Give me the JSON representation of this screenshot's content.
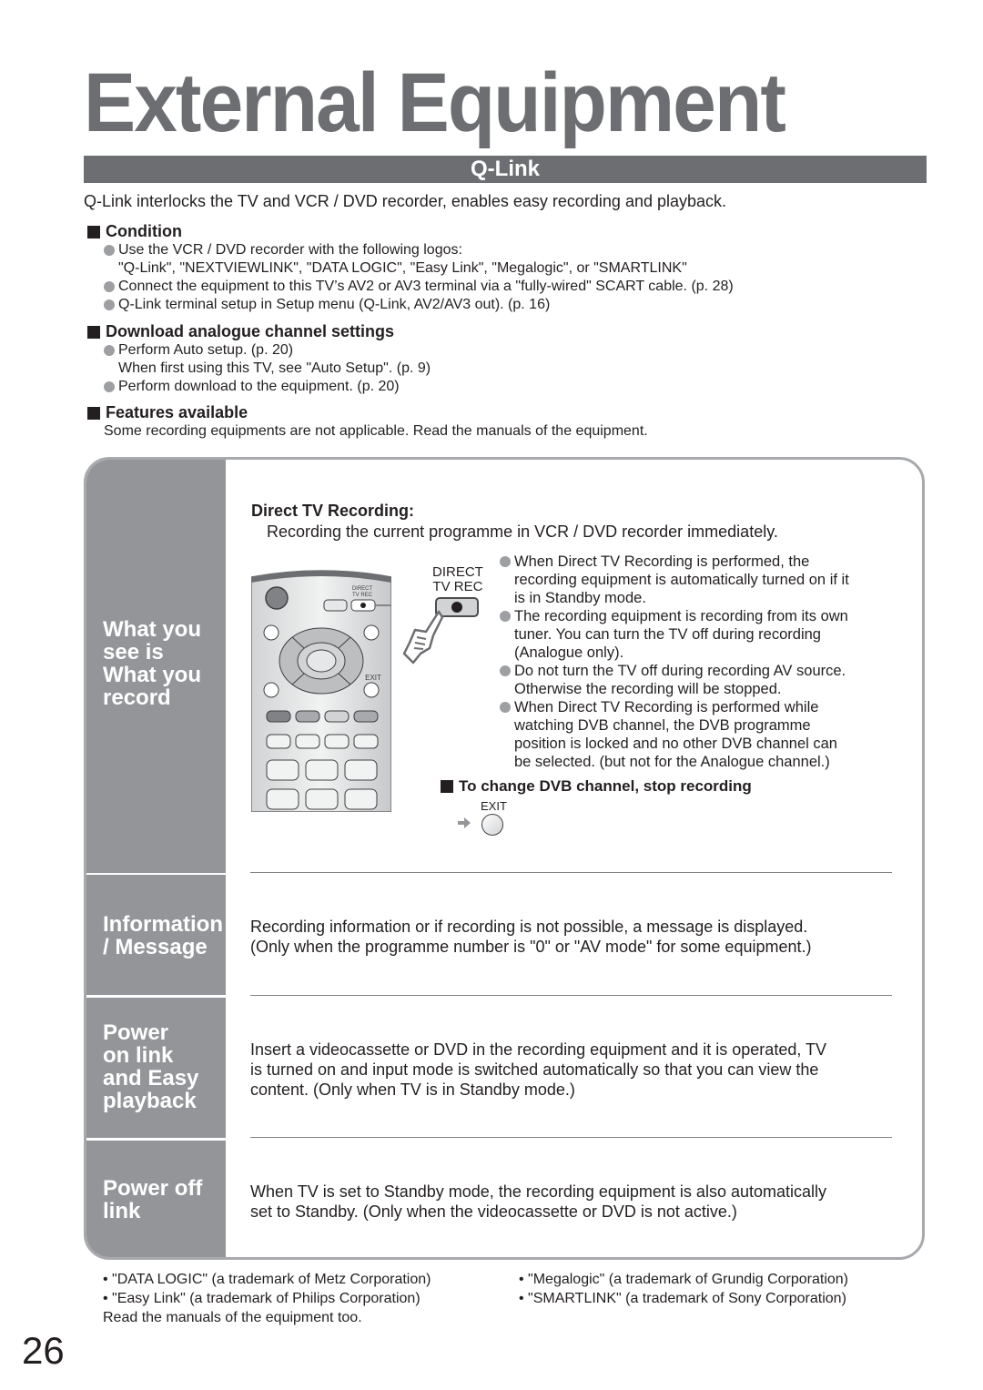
{
  "page": {
    "title": "External Equipment",
    "section": "Q-Link",
    "intro": "Q-Link interlocks the TV and VCR / DVD recorder, enables easy recording and playback.",
    "page_number": "26"
  },
  "condition": {
    "heading": "Condition",
    "items": [
      {
        "bullet": true,
        "text": "Use the VCR / DVD recorder with the following logos:"
      },
      {
        "bullet": false,
        "text": "\"Q-Link\", \"NEXTVIEWLINK\", \"DATA LOGIC\", \"Easy Link\", \"Megalogic\", or \"SMARTLINK\""
      },
      {
        "bullet": true,
        "text": "Connect the equipment to this TV’s AV2 or AV3 terminal via a \"fully-wired\" SCART cable. (p. 28)"
      },
      {
        "bullet": true,
        "text": "Q-Link terminal setup in Setup menu (Q-Link, AV2/AV3 out). (p. 16)"
      }
    ]
  },
  "download": {
    "heading": "Download analogue channel settings",
    "items": [
      {
        "bullet": true,
        "text": "Perform Auto setup. (p. 20)"
      },
      {
        "bullet": false,
        "text": "When first using this TV, see \"Auto Setup\". (p. 9)"
      },
      {
        "bullet": true,
        "text": "Perform download to the equipment. (p. 20)"
      }
    ]
  },
  "features": {
    "heading": "Features available",
    "note": "Some recording equipments are not applicable. Read the manuals of the equipment."
  },
  "rows": {
    "wysiwyr": {
      "label": [
        "What you",
        "see is",
        "What you",
        "record"
      ],
      "subtitle": "Direct TV Recording:",
      "description": "Recording the current programme in VCR / DVD recorder immediately.",
      "button_label_line1": "DIRECT",
      "button_label_line2": "TV REC",
      "remote_small_label1": "DIRECT",
      "remote_small_label2": "TV REC",
      "remote_exit_label": "EXIT",
      "bullets": [
        [
          "When Direct TV Recording is performed, the",
          "recording equipment is automatically turned on if it",
          "is in Standby mode."
        ],
        [
          "The recording equipment is recording from its own",
          "tuner. You can turn the TV off during recording",
          "(Analogue only)."
        ],
        [
          "Do not turn the TV off during recording AV source.",
          "Otherwise the recording will be stopped."
        ],
        [
          "When Direct TV Recording is performed while",
          "watching DVB channel, the DVB programme",
          "position is locked and no other DVB channel can",
          "be selected. (but not for the Analogue channel.)"
        ]
      ],
      "change_heading": "To change DVB channel, stop recording",
      "exit_label": "EXIT"
    },
    "info": {
      "label": [
        "Information",
        "/ Message"
      ],
      "lines": [
        "Recording information or if recording is not possible, a message is displayed.",
        "(Only when the programme number is \"0\" or \"AV mode\" for some equipment.)"
      ]
    },
    "power_on": {
      "label": [
        "Power",
        "on link",
        "and Easy",
        "playback"
      ],
      "lines": [
        "Insert a videocassette or DVD in the recording equipment and it is operated, TV",
        "is turned on and input mode is switched automatically so that you can view the",
        "content. (Only when TV is in Standby mode.)"
      ]
    },
    "power_off": {
      "label": [
        "Power off",
        "link"
      ],
      "lines": [
        "When TV is set to Standby mode, the recording equipment is also automatically",
        "set to Standby. (Only when the videocassette or DVD is not active.)"
      ]
    }
  },
  "footer": {
    "left": [
      "• \"DATA LOGIC\" (a trademark of Metz Corporation)",
      "• \"Easy Link\" (a trademark of Philips Corporation)",
      "Read the manuals of the equipment too."
    ],
    "right": [
      "• \"Megalogic\" (a trademark of Grundig Corporation)",
      "• \"SMARTLINK\" (a trademark of Sony Corporation)"
    ]
  }
}
